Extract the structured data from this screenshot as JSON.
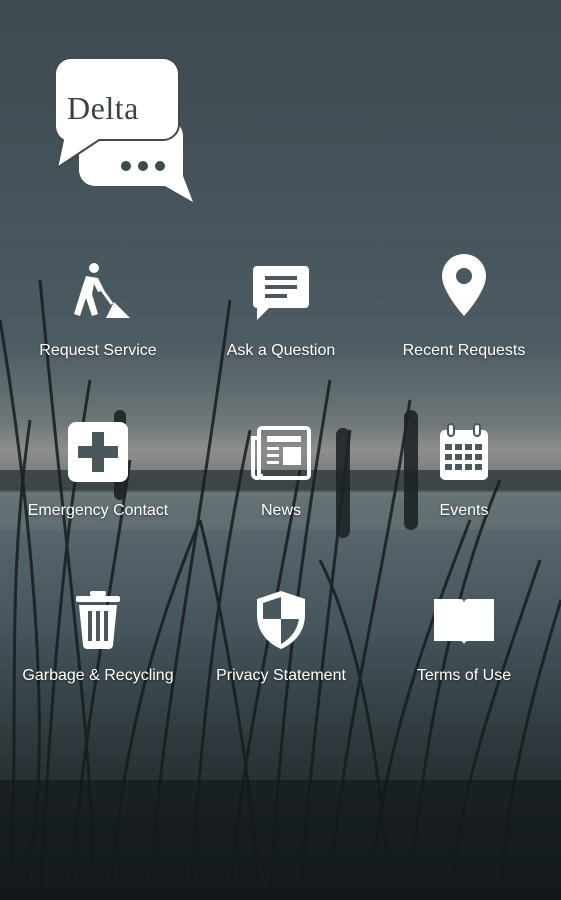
{
  "app": {
    "logo_text": "Delta"
  },
  "tiles": [
    {
      "label": "Request Service",
      "icon": "worker-shovel-icon"
    },
    {
      "label": "Ask a Question",
      "icon": "chat-bubble-icon"
    },
    {
      "label": "Recent Requests",
      "icon": "map-pin-icon"
    },
    {
      "label": "Emergency Contact",
      "icon": "medical-cross-icon"
    },
    {
      "label": "News",
      "icon": "newspaper-icon"
    },
    {
      "label": "Events",
      "icon": "calendar-icon"
    },
    {
      "label": "Garbage & Recycling",
      "icon": "trash-can-icon"
    },
    {
      "label": "Privacy Statement",
      "icon": "shield-icon"
    },
    {
      "label": "Terms of Use",
      "icon": "open-book-icon"
    }
  ]
}
